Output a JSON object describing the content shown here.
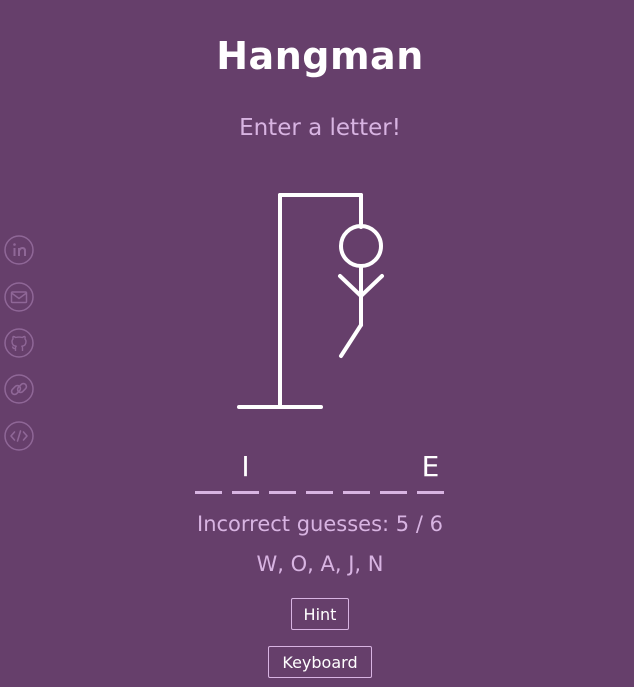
{
  "header": {
    "title": "Hangman",
    "prompt": "Enter a letter!"
  },
  "game": {
    "word_slots": [
      "",
      "I",
      "",
      "",
      "",
      "",
      "E"
    ],
    "incorrect_label": "Incorrect guesses:",
    "incorrect_count": "5",
    "separator": "/",
    "max_incorrect": "6",
    "guessed_letters": "W, O, A, J, N",
    "hint_label": "Hint",
    "keyboard_label": "Keyboard"
  },
  "sidebar": {
    "icons": [
      "linkedin-icon",
      "email-icon",
      "github-icon",
      "link-icon",
      "code-icon"
    ]
  },
  "colors": {
    "background": "#663f6b",
    "accent": "#d8b4e2",
    "foreground": "#ffffff"
  }
}
